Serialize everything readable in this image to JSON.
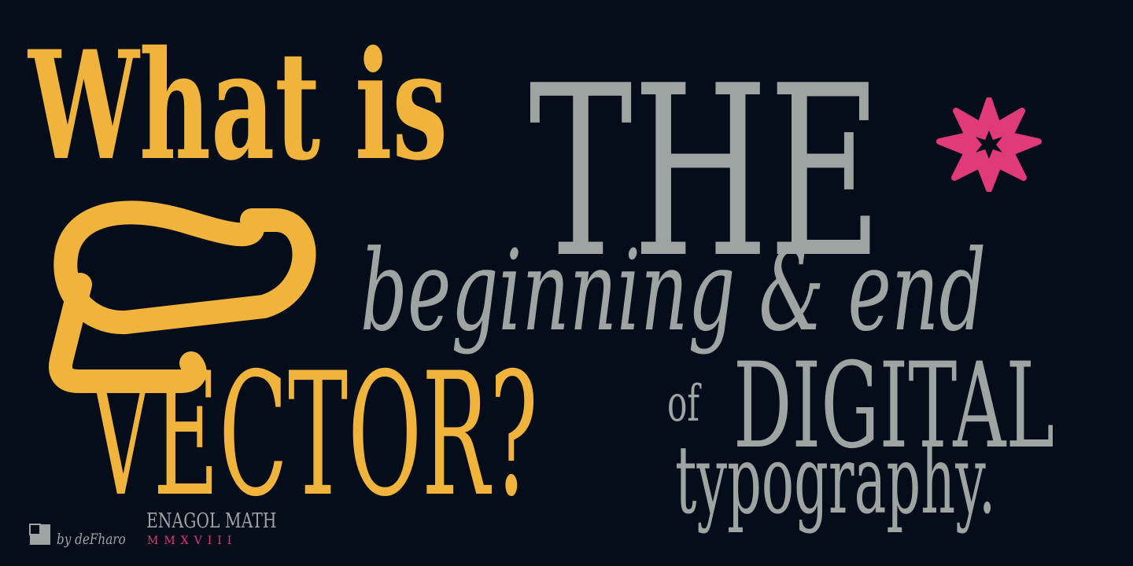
{
  "headline": {
    "what_is": "What is",
    "the": "THE",
    "beginning_end": "beginning & end",
    "vector": "VECTOR?",
    "of": "of",
    "digital": "DIGITAL",
    "typography": "typography."
  },
  "footer": {
    "by_line": "by deFharo",
    "font_name": "ENAGOL MATH",
    "year": "MMXVIII"
  },
  "colors": {
    "background": "#050c1a",
    "accent_yellow": "#f0b43c",
    "text_gray": "#9ea4a2",
    "star_pink": "#e03a78"
  },
  "icons": {
    "glyph": "math-glyph-icon",
    "star": "eight-point-star-icon",
    "brand": "defharo-logo-icon"
  }
}
